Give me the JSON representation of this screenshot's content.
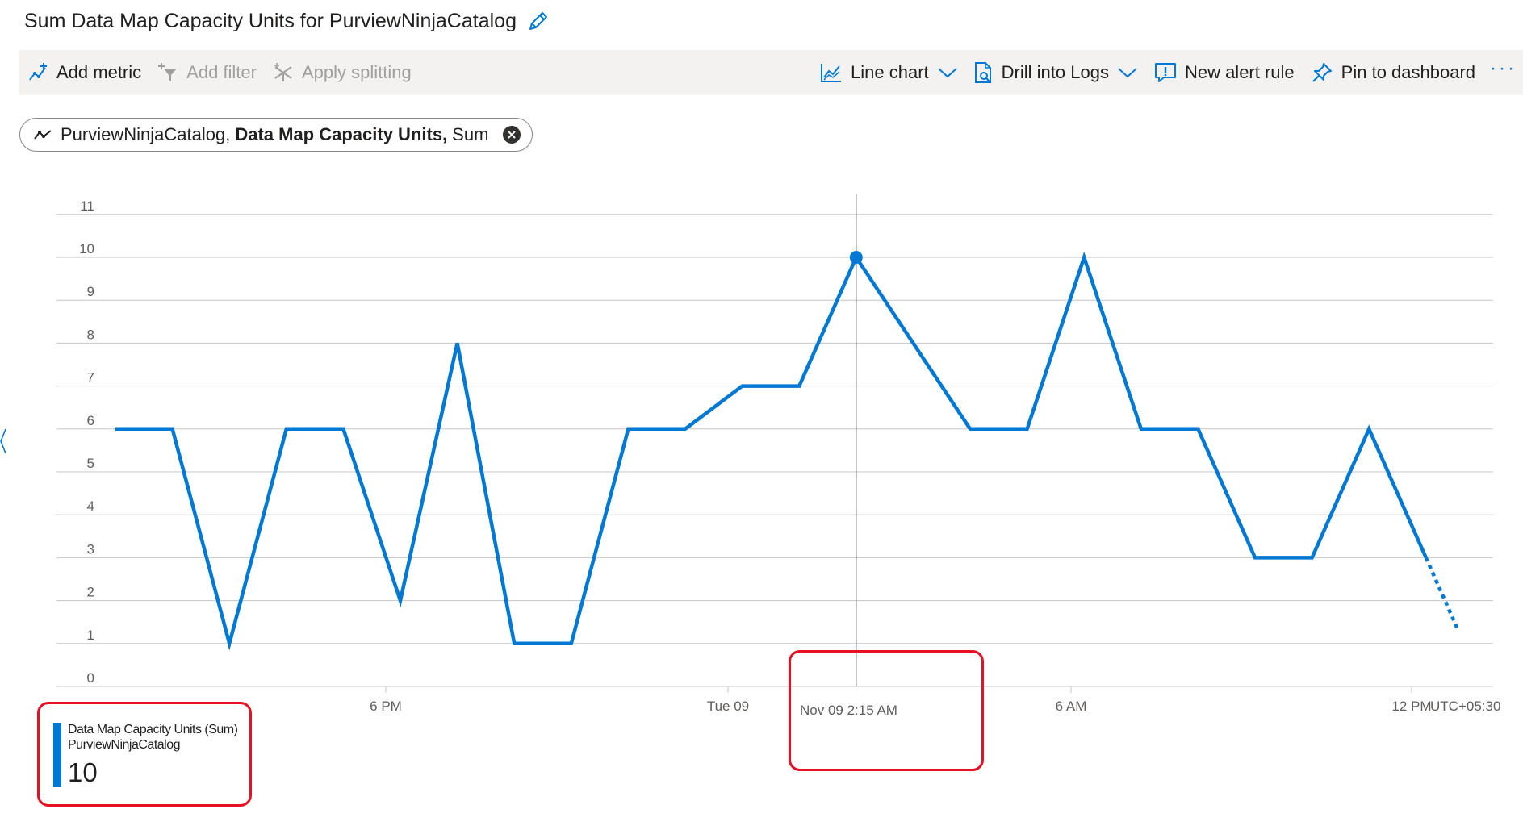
{
  "header": {
    "title": "Sum Data Map Capacity Units for PurviewNinjaCatalog",
    "edit_icon": "pencil-icon"
  },
  "toolbar": {
    "add_metric": "Add metric",
    "add_filter": "Add filter",
    "apply_splitting": "Apply splitting",
    "line_chart": "Line chart",
    "drill_into_logs": "Drill into Logs",
    "new_alert_rule": "New alert rule",
    "pin_to_dashboard": "Pin to dashboard",
    "more": "···"
  },
  "metric_pill": {
    "resource": "PurviewNinjaCatalog,",
    "metric": "Data Map Capacity Units,",
    "aggregation": "Sum"
  },
  "hover": {
    "timestamp": "Nov 09 2:15 AM"
  },
  "legend": {
    "name": "Data Map Capacity Units (Sum)",
    "resource": "PurviewNinjaCatalog",
    "value": "10"
  },
  "colors": {
    "series": "#0078d4",
    "highlight": "#e81123",
    "grid": "#c8c6c4"
  },
  "chart_data": {
    "type": "line",
    "ylim": [
      0,
      11
    ],
    "yticks": [
      "0",
      "1",
      "2",
      "3",
      "4",
      "5",
      "6",
      "7",
      "8",
      "9",
      "10",
      "11"
    ],
    "xticks": [
      "6 PM",
      "Tue 09",
      "6 AM",
      "12 PM"
    ],
    "timezone": "UTC+05:30",
    "grid": true,
    "series": [
      {
        "values": [
          6,
          6,
          1,
          6,
          6,
          2,
          8,
          1,
          1,
          6,
          6,
          7,
          7,
          10,
          8,
          6,
          6,
          10,
          6,
          6,
          3,
          3,
          6,
          3
        ],
        "partial_last_value": 1.3
      }
    ],
    "highlighted_point_value": 10
  }
}
